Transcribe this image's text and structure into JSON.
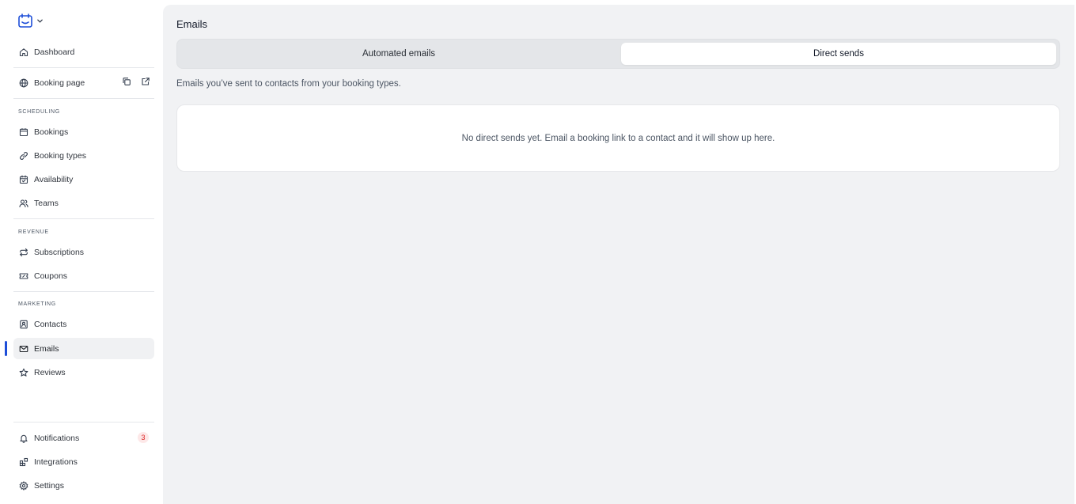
{
  "sidebar": {
    "brand_icon": "calendar-logo-icon",
    "top_items": [
      {
        "label": "Dashboard",
        "icon": "home-icon"
      }
    ],
    "booking_page": {
      "label": "Booking page",
      "icon": "globe-icon",
      "copy_icon": "copy-icon",
      "open_icon": "external-link-icon"
    },
    "sections": [
      {
        "title": "Scheduling",
        "items": [
          {
            "label": "Bookings",
            "icon": "calendar-icon"
          },
          {
            "label": "Booking types",
            "icon": "link-icon"
          },
          {
            "label": "Availability",
            "icon": "calendar-check-icon"
          },
          {
            "label": "Teams",
            "icon": "users-icon"
          }
        ]
      },
      {
        "title": "Revenue",
        "items": [
          {
            "label": "Subscriptions",
            "icon": "repeat-icon"
          },
          {
            "label": "Coupons",
            "icon": "ticket-icon"
          }
        ]
      },
      {
        "title": "Marketing",
        "items": [
          {
            "label": "Contacts",
            "icon": "contact-icon"
          },
          {
            "label": "Emails",
            "icon": "mail-icon",
            "active": true
          },
          {
            "label": "Reviews",
            "icon": "star-icon"
          }
        ]
      }
    ],
    "bottom_items": [
      {
        "label": "Notifications",
        "icon": "bell-icon",
        "badge": "3"
      },
      {
        "label": "Integrations",
        "icon": "integrations-icon"
      },
      {
        "label": "Settings",
        "icon": "gear-icon"
      }
    ],
    "accent_color": "#1d4ed8"
  },
  "main": {
    "title": "Emails",
    "tabs": [
      {
        "label": "Automated emails",
        "selected": false
      },
      {
        "label": "Direct sends",
        "selected": true
      }
    ],
    "subtitle": "Emails you’ve sent to contacts from your booking types.",
    "empty_message": "No direct sends yet. Email a booking link to a contact and it will show up here."
  }
}
